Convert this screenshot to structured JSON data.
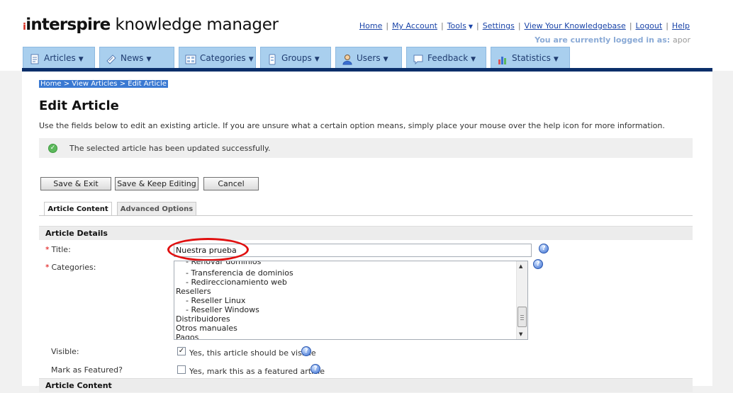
{
  "header": {
    "logo_brand": "interspire",
    "logo_product": "knowledge manager",
    "links": {
      "home": "Home",
      "my_account": "My Account",
      "tools": "Tools",
      "settings": "Settings",
      "view_kb": "View Your Knowledgebase",
      "logout": "Logout",
      "help": "Help"
    },
    "logged_in_label": "You are currently logged in as:",
    "logged_in_user": "apor"
  },
  "nav": {
    "tabs": [
      {
        "label": "Articles",
        "icon": "articles-icon"
      },
      {
        "label": "News",
        "icon": "news-icon"
      },
      {
        "label": "Categories",
        "icon": "categories-icon"
      },
      {
        "label": "Groups",
        "icon": "groups-icon"
      },
      {
        "label": "Users",
        "icon": "users-icon"
      },
      {
        "label": "Feedback",
        "icon": "feedback-icon"
      },
      {
        "label": "Statistics",
        "icon": "statistics-icon"
      }
    ]
  },
  "breadcrumb": {
    "home": "Home",
    "view_articles": "View Articles",
    "edit_article": "Edit Article",
    "separator": ">"
  },
  "page": {
    "title": "Edit Article",
    "intro": "Use the fields below to edit an existing article. If you are unsure what a certain option means, simply place your mouse over the help icon for more information.",
    "success_message": "The selected article has been updated successfully."
  },
  "buttons": {
    "save_exit": "Save & Exit",
    "save_keep": "Save & Keep Editing",
    "cancel": "Cancel"
  },
  "subtabs": {
    "article_content": "Article Content",
    "advanced_options": "Advanced Options"
  },
  "article_details": {
    "section_title": "Article Details",
    "title_label": "Title:",
    "title_value": "Nuestra prueba",
    "categories_label": "Categories:",
    "categories": [
      "- Renovar dominios",
      "- Transferencia de dominios",
      "- Redireccionamiento web",
      "Resellers",
      "- Reseller Linux",
      "- Reseller Windows",
      "Distribuidores",
      "Otros manuales",
      "Pagos"
    ],
    "visible_label": "Visible:",
    "visible_text": "Yes, this article should be visible",
    "visible_checked": true,
    "featured_label": "Mark as Featured?",
    "featured_text": "Yes, mark this as a featured article",
    "featured_checked": false
  },
  "next_section": {
    "title": "Article Content"
  },
  "colors": {
    "nav_tab_bg": "#a9cfee",
    "nav_line": "#0b2f6a",
    "link": "#1a44a8",
    "highlight_circle": "#e01010"
  }
}
